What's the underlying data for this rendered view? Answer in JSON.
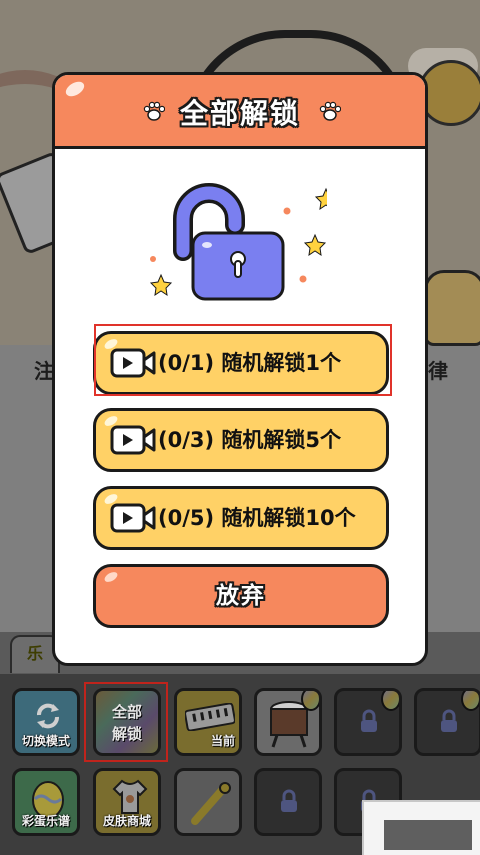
{
  "modal": {
    "title": "全部解锁",
    "options": [
      {
        "progress": "(0/1)",
        "label": "随机解锁1个"
      },
      {
        "progress": "(0/3)",
        "label": "随机解锁5个"
      },
      {
        "progress": "(0/5)",
        "label": "随机解锁10个"
      }
    ],
    "cancel_label": "放弃"
  },
  "background": {
    "tab_label": "乐",
    "left_edge_text": "注",
    "right_edge_text": "律"
  },
  "tray": {
    "row1": [
      {
        "label": "切换模式",
        "icon": "refresh-icon"
      },
      {
        "label_line1": "全部",
        "label_line2": "解锁"
      },
      {
        "label": "当前",
        "icon": "keyboard-icon"
      },
      {
        "icon": "drum-icon"
      },
      {
        "icon": "lock-icon"
      },
      {
        "icon": "dancer-icon"
      }
    ],
    "row2": [
      {
        "label": "彩蛋乐谱",
        "icon": "egg-icon"
      },
      {
        "label": "皮肤商城",
        "icon": "shirt-icon"
      },
      {
        "icon": "rubber-chicken-icon"
      },
      {
        "icon": "lock-icon"
      },
      {
        "icon": "lock-icon"
      }
    ]
  },
  "colors": {
    "header": "#f6885d",
    "option_button": "#ffd166",
    "cancel_button": "#f6885d",
    "lock_body": "#7a7ff0",
    "highlight": "#e0332a"
  }
}
